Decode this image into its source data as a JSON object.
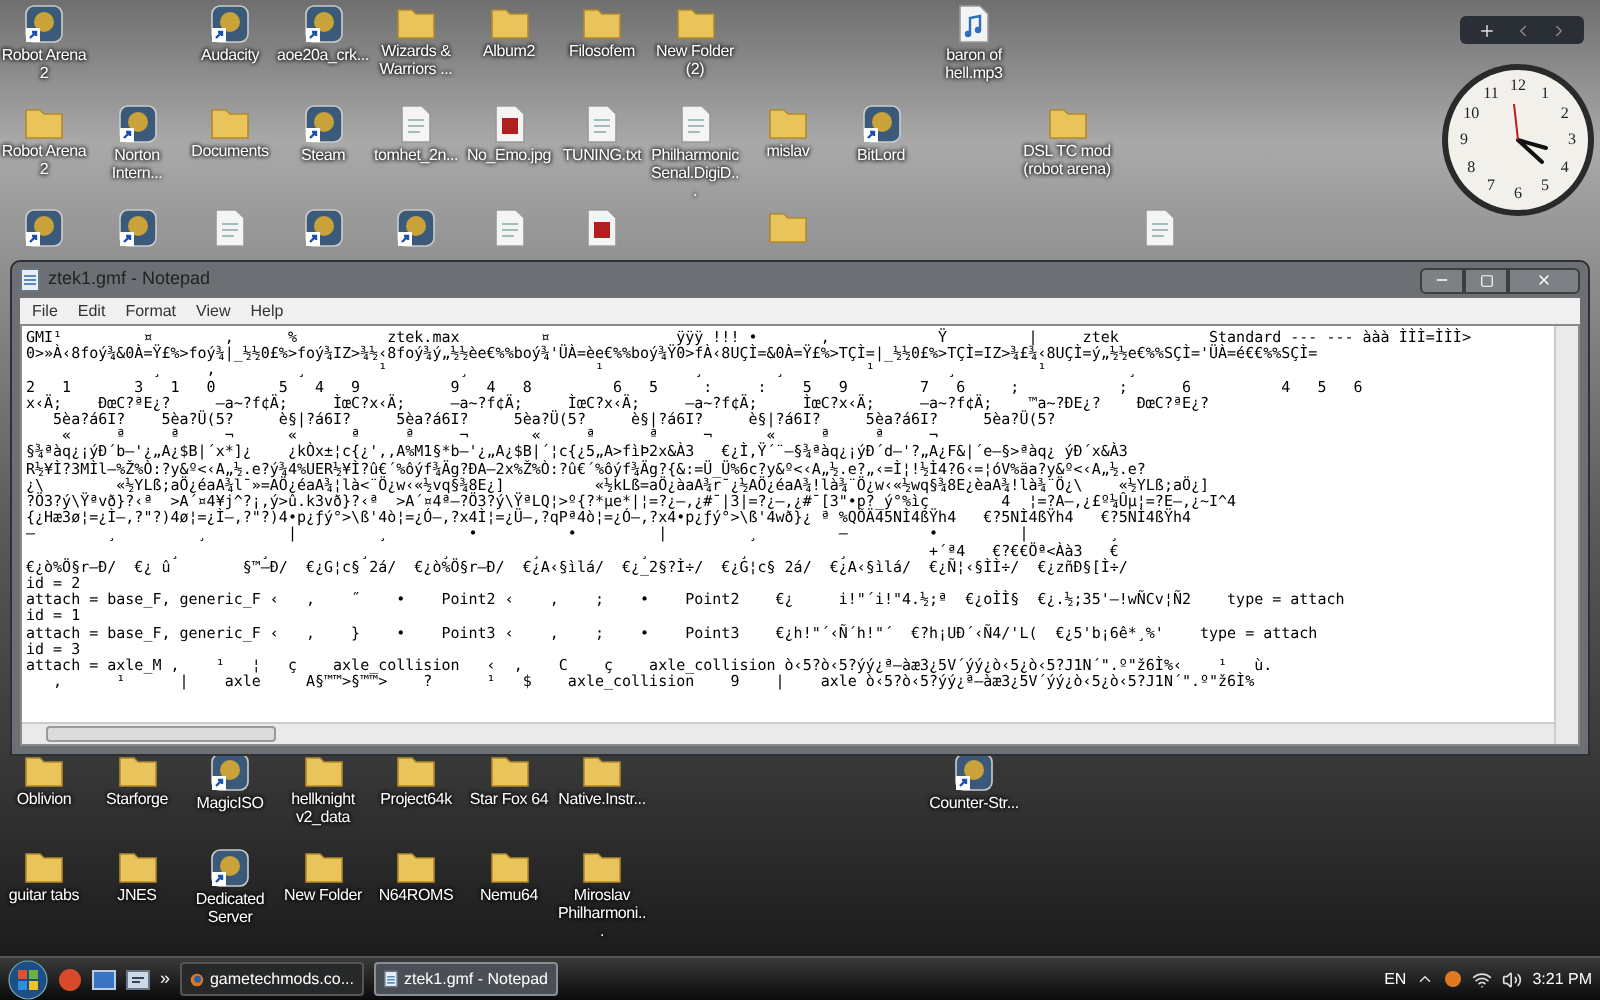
{
  "desktop": {
    "icons": [
      {
        "kind": "program",
        "label": "Robot Arena 2"
      },
      {
        "kind": "program",
        "label": "Audacity"
      },
      {
        "kind": "program",
        "label": "aoe20a_crk..."
      },
      {
        "kind": "folder",
        "label": "Wizards & Warriors ..."
      },
      {
        "kind": "folder",
        "label": "Album2"
      },
      {
        "kind": "folder",
        "label": "Filosofem"
      },
      {
        "kind": "folder",
        "label": "New Folder (2)"
      },
      {
        "kind": "audio",
        "label": "baron of hell.mp3"
      },
      {
        "kind": "folder",
        "label": "Robot Arena 2"
      },
      {
        "kind": "program",
        "label": "Norton Intern..."
      },
      {
        "kind": "folder",
        "label": "Documents"
      },
      {
        "kind": "program",
        "label": "Steam"
      },
      {
        "kind": "document",
        "label": "tomhet_2n..."
      },
      {
        "kind": "image",
        "label": "No_Emo.jpg"
      },
      {
        "kind": "document",
        "label": "TUNING.txt"
      },
      {
        "kind": "document",
        "label": "Philharmonic Senal.DigiD..."
      },
      {
        "kind": "folder",
        "label": "mislav"
      },
      {
        "kind": "program",
        "label": "BitLord"
      },
      {
        "kind": "folder",
        "label": "DSL TC mod (robot arena)"
      },
      {
        "kind": "program"
      },
      {
        "kind": "program"
      },
      {
        "kind": "document"
      },
      {
        "kind": "program"
      },
      {
        "kind": "program"
      },
      {
        "kind": "document"
      },
      {
        "kind": "image"
      },
      {
        "kind": "folder"
      },
      {
        "kind": "document"
      },
      {
        "kind": "folder",
        "label": "Oblivion"
      },
      {
        "kind": "folder",
        "label": "Starforge"
      },
      {
        "kind": "program",
        "label": "MagicISO"
      },
      {
        "kind": "folder",
        "label": "hellknight v2_data"
      },
      {
        "kind": "folder",
        "label": "Project64k"
      },
      {
        "kind": "folder",
        "label": "Star Fox 64"
      },
      {
        "kind": "folder",
        "label": "Native.Instr..."
      },
      {
        "kind": "program",
        "label": "Counter-Str..."
      },
      {
        "kind": "folder",
        "label": "guitar tabs"
      },
      {
        "kind": "folder",
        "label": "JNES"
      },
      {
        "kind": "program",
        "label": "Dedicated Server"
      },
      {
        "kind": "folder",
        "label": "New Folder"
      },
      {
        "kind": "folder",
        "label": "N64ROMS"
      },
      {
        "kind": "folder",
        "label": "Nemu64"
      },
      {
        "kind": "folder",
        "label": "Miroslav Philharmoni..."
      }
    ]
  },
  "clock": {
    "dial_numbers": [
      "12",
      "1",
      "2",
      "3",
      "4",
      "5",
      "6",
      "7",
      "8",
      "9",
      "10",
      "11"
    ]
  },
  "notepad": {
    "title": "ztek1.gmf - Notepad",
    "menu": [
      "File",
      "Edit",
      "Format",
      "View",
      "Help"
    ],
    "lines": [
      "GMI¹         ¤        ,      %          ztek.max         ¤              ÿÿÿ !!! •       ,            Ÿ         |     ztek          Standard --- --- ààà ÌÌÌ=ÌÌÌ>",
      "0>»À‹8foý¾&0À=Ÿ£%>foý¾|_½½0£%>foý¾IZ>¾½‹8foý¾ý„½½èe€%%boý¾'ÜÀ=èe€%%boý¾Ÿ0>fÀ‹8UÇÌ=&0À=Ÿ£%>TÇÌ=|_½½0£%>TÇÌ=IZ>¾£¾‹8UÇÌ=ý„½½e€%%SÇÌ='ÜÀ=é€€%%SÇÌ=",
      "              ¸     ,         ¸        ¹        ¸              ¹          ¸        ¸         ¹        ¸         ¹         ¸",
      "2   1       3   1   0       5   4   9          9   4   8         6   5     :     :    5   9        7   6     ;           ;      6          4   5   6",
      "x‹Ä;    ÐœC?ªE¿?     –a~?f¢Ä;     ÌœC?x‹Ä;     –a~?f¢Ä;     ÌœC?x‹Ä;     –a~?f¢Ä;     ÌœC?x‹Ä;     –a~?f¢Ä;    ™a~?ÐE¿?    ÐœC?ªE¿?",
      "   5èa?á6I?    5èa?Ü(5?     è§|?á6I?     5èa?á6I?     5èa?Ü(5?     è§|?á6I?     è§|?á6I?     5èa?á6I?     5èa?Ü(5?",
      "    «     ª     ª     ¬      «      ª     ª     ¬       «     ª      ª     ¬      «     ª     ª     ¬",
      "§¾ªàq¿¡ýÐ´b–'¿„A¿$B|´x*]¿    ¿kÒx±¦c{¿',,A%M1§*b–'¿„A¿$B|´¦c{¿5„A>fìÞ2x&À3   €¿Ì,Ÿ´¨–§¾ªàq¿¡ýÐ´d–'?„A¿F&|´e–§>ªàq¿ ýÐ´x&À3",
      "R½¥Ì?3MÌl–%Ž%Ò:?y&º<‹A„½.e?ý¾4%UER½¥Ì?û€´%ôýf¾Äg?ÐA–2x%Ž%Ò:?û€´%ôýf¾Äg?{&:=Ü_Ü%6c?y&º<‹A„½.e?„‹=Ì¦!½Ì4?6‹=¦óV%äa?y&º<‹A„½.e?",
      "¿\\        «½YLß;aÖ¿éaA¾l¯»=AÖ¿éaA¾¦là<¨Ö¿w‹«½vq§¾8E¿]          «½kLß=aÖ¿àaA¾r¯¿½AÖ¿éaA¾!là¾¨Ö¿w‹«½wq§¾8E¿èaA¾!là¾¨Ö¿\\    «½YLß;aÖ¿]",
      "?Ö3?ý\\Ÿªvð}?‹ª  >A´¤4¥j^?¡,ý>û.k3vð}?‹ª  >A´¤4ª–?Ö3?ý\\ŸªLQ¦>º{?*µe*|¦=?¿–,¿#¯|3|=?¿–,¿#¯[3\"•p?_ý°%ìç        4  ¦=?A–,¿£º¼Ûµ¦=?E–,¿~I^4",
      "{¿Hæ3ø¦=¿Ì–,?\"?)4ø¦=¿Ì–,?\"?)4•p¿ƒý°>\\ß'4ò¦=¿Ó–,?x4Ì¦=¿Ü–,?qPª4ò¦=¿Ó–,?x4•p¿ƒý°>\\ß'4wð}¿ ª %QÕÄ45NÌ4ßŸh4   €?5NÌ4ßŸh4   €?5NÌ4ßŸh4",
      "–        ¸         ¸         |         ¸         •          •         |         ¸         –         •         |         ¸",
      "                ¸         ¸          ¸        ¸         ¸           ¸          ¸          ¸         +´ª4   €?€€Öª<Àà3   €",
      "€¿ò%Ö§r–Ð/  €¿ û        §™–Ð/  €¿G¦c§ 2á/  €¿ò%Ö§r–Ð/  €¿A‹§ìlá/  €¿_2§?Ì÷/  €¿G¦c§ 2á/  €¿A‹§ìlá/  €¿Ñ¦‹§ÌÌ÷/  €¿zñÐ§[Ì÷/",
      "id = 2",
      "attach = base_F, generic_F ‹   ,    ˝    •    Point2 ‹    ,    ;    •    Point2    €¿     i!\"´i!\"4.½;ª  €¿oÌÌ§  €¿.½;35'–!wÑCv¦Ñ2    type = attach",
      "id = 1",
      "attach = base_F, generic_F ‹   ,    }    •    Point3 ‹    ,    ;    •    Point3    €¿h!\"´‹Ñ´h!\"´  €?h¡UÐ´‹Ñ4/'L(  €¿5'b¡6ê*¸%'    type = attach",
      "id = 3",
      "attach = axle_M ,    ¹   ¦   ç    axle_collision   ‹  ,    C    ç    axle_collision ò‹5?ò‹5?ýý¿ª–àæ3¿5V´ýý¿ò‹5¿ò‹5?J1N´\".º\"ž6Ì%‹    ¹   ù.",
      "   ,      ¹      |    axle     A§™™>§™™>    ?      ¹   $    axle_collision    9    |    axle ò‹5?ò‹5?ýý¿ª–àæ3¿5V´ýý¿ò‹5¿ò‹5?J1N´\".º\"ž6Ì%"
    ]
  },
  "taskbar": {
    "more": "»",
    "tasks": [
      {
        "label": "gametechmods.co...",
        "kind": "browser",
        "selected": false
      },
      {
        "label": "ztek1.gmf - Notepad",
        "kind": "notepad",
        "selected": true
      }
    ],
    "language": "EN",
    "time": "3:21 PM"
  }
}
